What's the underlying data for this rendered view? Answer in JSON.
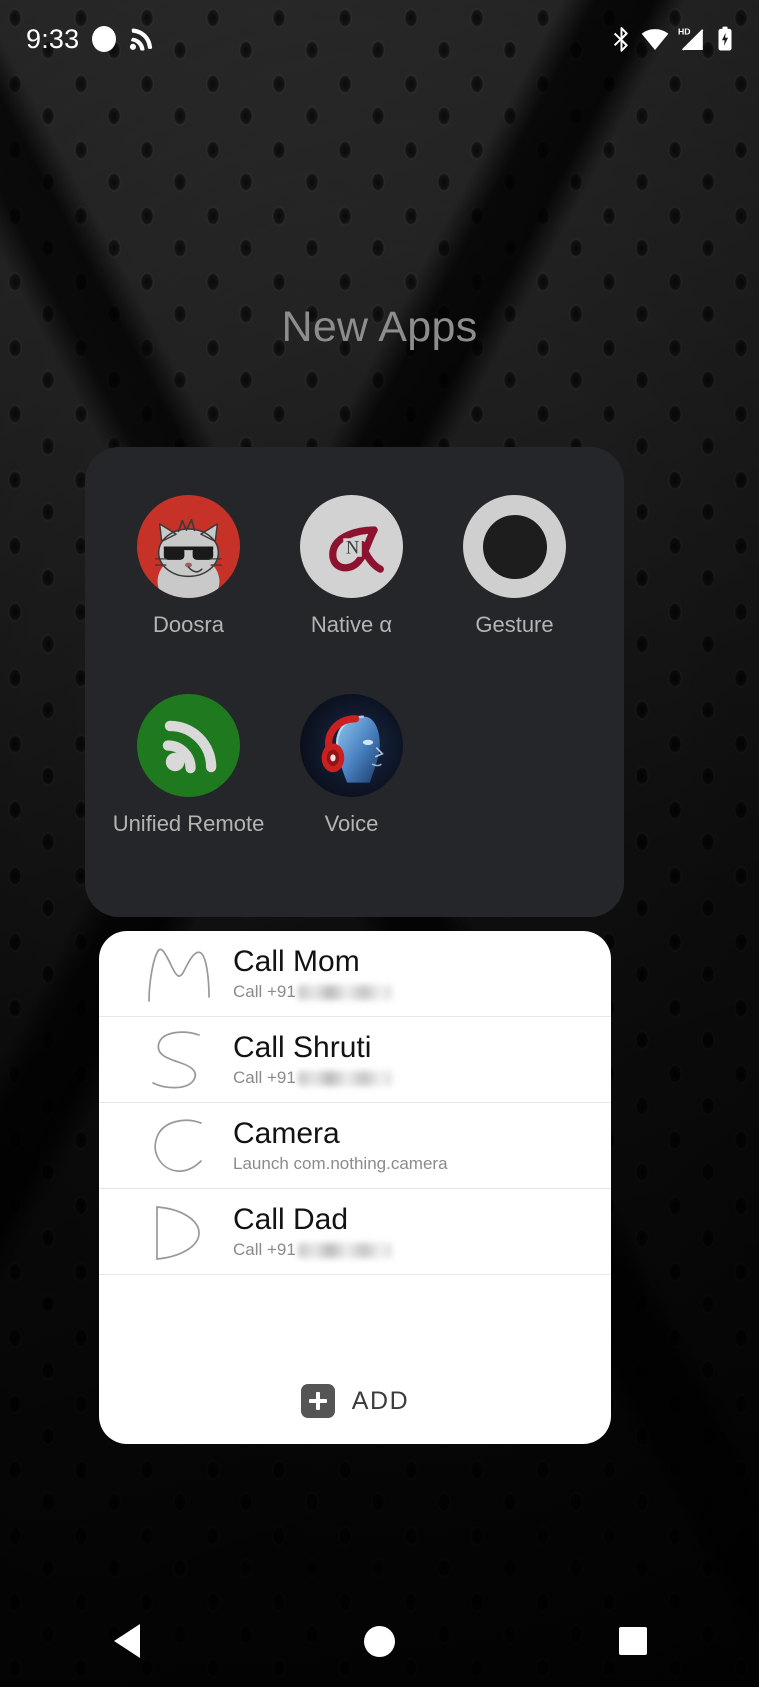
{
  "status_bar": {
    "time": "9:33",
    "left_icons": [
      {
        "name": "record-dot-icon"
      },
      {
        "name": "cast-icon"
      }
    ],
    "right_icons": [
      {
        "name": "bluetooth-icon"
      },
      {
        "name": "wifi-icon"
      },
      {
        "name": "hd-label",
        "text": "HD"
      },
      {
        "name": "cellular-signal-icon"
      },
      {
        "name": "battery-charging-icon"
      }
    ]
  },
  "folder": {
    "title": "New Apps",
    "apps": [
      {
        "label": "Doosra",
        "icon": "doosra-app-icon",
        "color": "#c63228"
      },
      {
        "label": "Native α",
        "icon": "native-alpha-app-icon",
        "color": "#d2d2d2"
      },
      {
        "label": "Gesture",
        "icon": "gesture-app-icon",
        "color": "#cfcfcf"
      },
      {
        "label": "Unified Remote",
        "icon": "unified-remote-app-icon",
        "color": "#1f7a1f"
      },
      {
        "label": "Voice",
        "icon": "voice-app-icon",
        "color": "#0d1424"
      }
    ]
  },
  "gesture_card": {
    "rows": [
      {
        "glyph": "M",
        "title": "Call Mom",
        "subtitle_prefix": "Call +91",
        "redacted": true
      },
      {
        "glyph": "S",
        "title": "Call Shruti",
        "subtitle_prefix": "Call +91",
        "redacted": true
      },
      {
        "glyph": "C",
        "title": "Camera",
        "subtitle_prefix": "Launch com.nothing.camera",
        "redacted": false
      },
      {
        "glyph": "D",
        "title": "Call Dad",
        "subtitle_prefix": "Call +91",
        "redacted": true
      }
    ],
    "add_label": "ADD"
  },
  "nav_bar": {
    "back_label": "Back",
    "home_label": "Home",
    "recents_label": "Recents"
  },
  "colors": {
    "panel_bg": "#252629",
    "card_bg": "#ffffff",
    "title_text": "#8d8d8d",
    "app_label": "#b4b4b4"
  }
}
